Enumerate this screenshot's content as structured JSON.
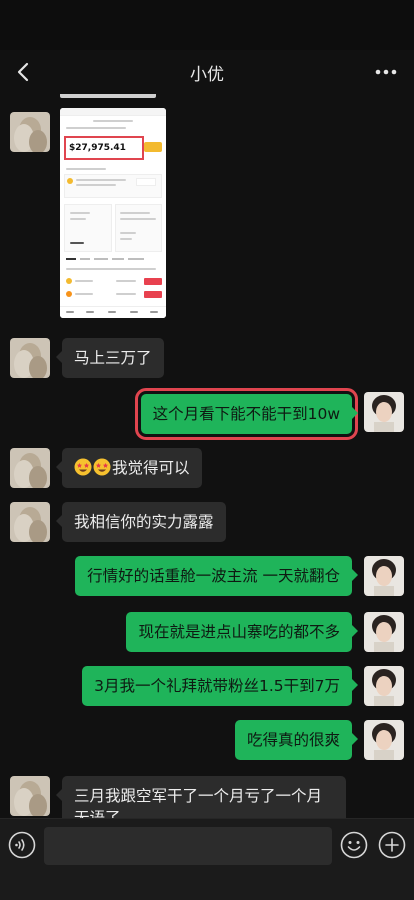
{
  "header": {
    "title": "小优",
    "back_icon": "chevron-left-icon",
    "more_icon": "more-dots-icon"
  },
  "screenshot_message": {
    "balance": "$27,975.41"
  },
  "messages": [
    {
      "side": "left",
      "text": "马上三万了"
    },
    {
      "side": "right",
      "text": "这个月看下能不能干到10w",
      "highlight": true
    },
    {
      "side": "left",
      "emoji": "star-struck-emoji",
      "text": "我觉得可以"
    },
    {
      "side": "left",
      "text": "我相信你的实力露露"
    },
    {
      "side": "right",
      "text": "行情好的话重舱一波主流 一天就翻仓"
    },
    {
      "side": "right",
      "text": "现在就是进点山寨吃的都不多"
    },
    {
      "side": "right",
      "text": "3月我一个礼拜就带粉丝1.5干到7万"
    },
    {
      "side": "right",
      "text": "吃得真的很爽"
    },
    {
      "side": "left",
      "text": "三月我跟空军干了一个月亏了一个月无语了"
    }
  ],
  "input_bar": {
    "voice_icon": "voice-icon",
    "emoji_icon": "emoji-icon",
    "plus_icon": "plus-icon"
  },
  "colors": {
    "background": "#111111",
    "bubble_gray": "#2c2c2c",
    "bubble_green": "#1fb45a",
    "highlight_red": "#e0454f"
  }
}
